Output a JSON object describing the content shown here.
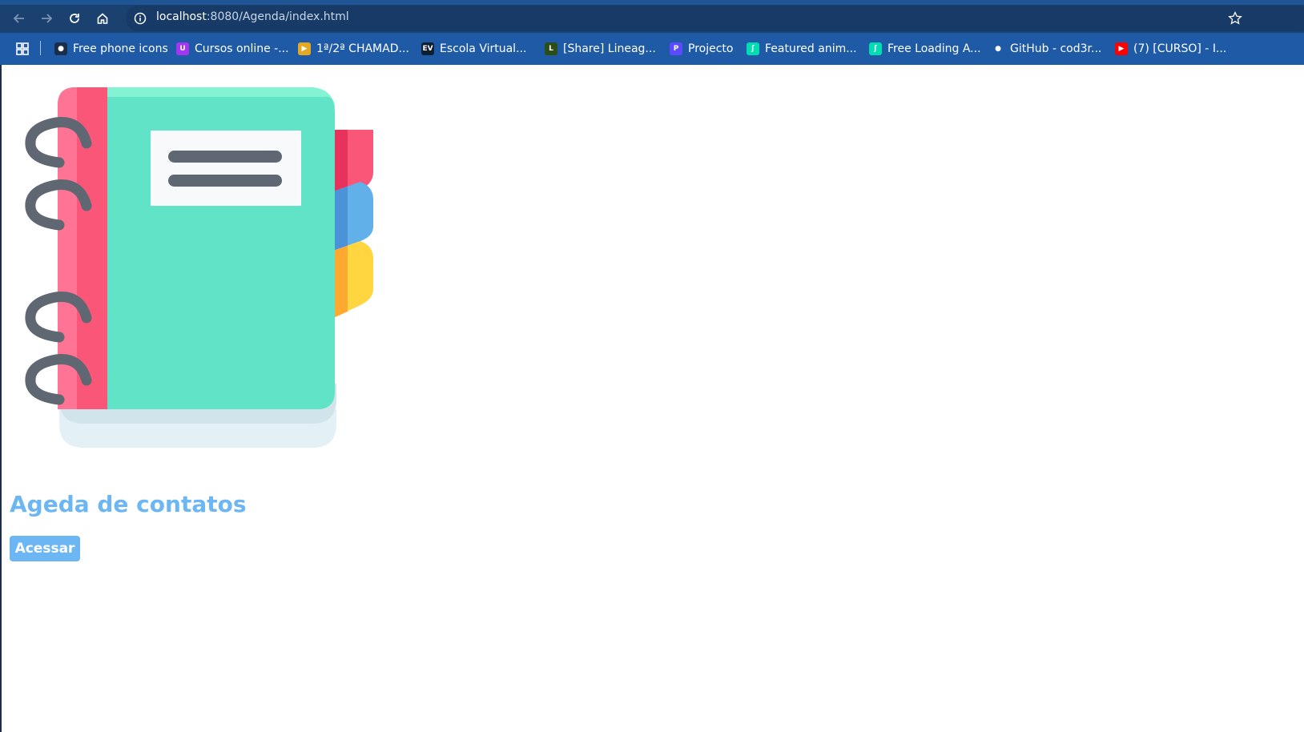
{
  "browser": {
    "url_host": "localhost",
    "url_path": ":8080/Agenda/index.html",
    "bookmarks": [
      {
        "label": "Free phone icons",
        "icon": "flaticon-icon",
        "color": "#1b2f4a",
        "glyph": "●"
      },
      {
        "label": "Cursos online -...",
        "icon": "udemy-icon",
        "color": "#a435f0",
        "glyph": "U"
      },
      {
        "label": "1ª/2ª CHAMAD...",
        "icon": "flag-icon",
        "color": "#e5a823",
        "glyph": "▶"
      },
      {
        "label": "Escola Virtual...",
        "icon": "ev-icon",
        "color": "#0d1f33",
        "glyph": "EV"
      },
      {
        "label": "[Share] Lineag...",
        "icon": "lineage-icon",
        "color": "#2d4d16",
        "glyph": "L"
      },
      {
        "label": "Projecto",
        "icon": "projecto-icon",
        "color": "#5a4bff",
        "glyph": "P"
      },
      {
        "label": "Featured anim...",
        "icon": "lottie-icon",
        "color": "#00ddb3",
        "glyph": "ʃ"
      },
      {
        "label": "Free Loading A...",
        "icon": "lottie-icon",
        "color": "#00ddb3",
        "glyph": "ʃ"
      },
      {
        "label": "GitHub - cod3r...",
        "icon": "github-icon",
        "color": "#1e5aa6",
        "glyph": "●"
      },
      {
        "label": "(7) [CURSO] - I...",
        "icon": "youtube-icon",
        "color": "#ff0000",
        "glyph": "▶"
      }
    ]
  },
  "page": {
    "title": "Ageda de contatos",
    "button_label": "Acessar",
    "accent_color": "#6cb6f3"
  }
}
